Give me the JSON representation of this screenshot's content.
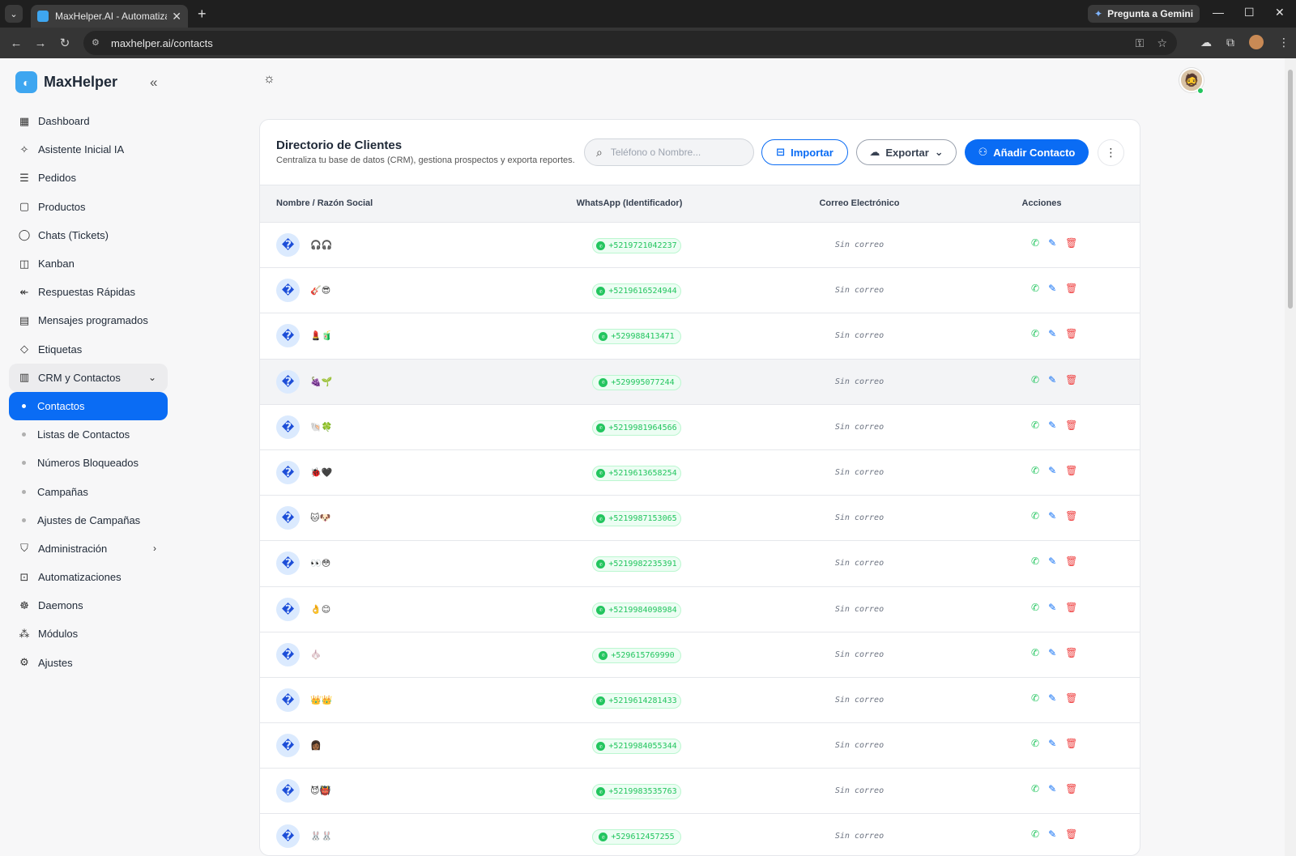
{
  "browser": {
    "tab_title": "MaxHelper.AI - Automatiza tu a",
    "url": "maxhelper.ai/contacts",
    "gemini_label": "Pregunta a Gemini"
  },
  "sidebar": {
    "brand": "MaxHelper",
    "items": [
      {
        "label": "Dashboard",
        "icon": "dashboard-icon"
      },
      {
        "label": "Asistente Inicial IA",
        "icon": "sparkle-icon"
      },
      {
        "label": "Pedidos",
        "icon": "document-icon"
      },
      {
        "label": "Productos",
        "icon": "shopping-bag-icon"
      },
      {
        "label": "Chats (Tickets)",
        "icon": "whatsapp-icon"
      },
      {
        "label": "Kanban",
        "icon": "kanban-icon"
      },
      {
        "label": "Respuestas Rápidas",
        "icon": "reply-all-icon"
      },
      {
        "label": "Mensajes programados",
        "icon": "calendar-icon"
      },
      {
        "label": "Etiquetas",
        "icon": "tag-icon"
      }
    ],
    "crm_group": {
      "label": "CRM y Contactos",
      "icon": "contacts-book-icon"
    },
    "crm_subitems": [
      {
        "label": "Contactos",
        "active": true
      },
      {
        "label": "Listas de Contactos"
      },
      {
        "label": "Números Bloqueados"
      },
      {
        "label": "Campañas"
      },
      {
        "label": "Ajustes de Campañas"
      }
    ],
    "bottom_items": [
      {
        "label": "Administración",
        "icon": "shield-user-icon"
      },
      {
        "label": "Automatizaciones",
        "icon": "robot-icon"
      },
      {
        "label": "Daemons",
        "icon": "daemon-icon"
      },
      {
        "label": "Módulos",
        "icon": "modules-icon"
      },
      {
        "label": "Ajustes",
        "icon": "gear-icon"
      }
    ]
  },
  "card": {
    "title": "Directorio de Clientes",
    "subtitle": "Centraliza tu base de datos (CRM), gestiona prospectos y exporta reportes.",
    "search_placeholder": "Teléfono o Nombre...",
    "import_label": "Importar",
    "export_label": "Exportar",
    "add_label": "Añadir Contacto"
  },
  "table": {
    "headers": {
      "name": "Nombre / Razón Social",
      "whatsapp": "WhatsApp (Identificador)",
      "email": "Correo Electrónico",
      "actions": "Acciones"
    },
    "avatar_glyph": "�",
    "no_email": "Sin correo",
    "rows": [
      {
        "name": "🎧🎧",
        "phone": "+5219721042237"
      },
      {
        "name": "🎸😎",
        "phone": "+5219616524944"
      },
      {
        "name": "💄🧃",
        "phone": "+529988413471"
      },
      {
        "name": "🍇🌱",
        "phone": "+529995077244"
      },
      {
        "name": "🐚🍀",
        "phone": "+5219981964566"
      },
      {
        "name": "🐞🖤",
        "phone": "+5219613658254"
      },
      {
        "name": "🐱🐶",
        "phone": "+5219987153065"
      },
      {
        "name": "👀😳",
        "phone": "+5219982235391"
      },
      {
        "name": "👌😊",
        "phone": "+5219984098984"
      },
      {
        "name": "🧄",
        "phone": "+529615769990"
      },
      {
        "name": "👑👑",
        "phone": "+5219614281433"
      },
      {
        "name": "👩🏾",
        "phone": "+5219984055344"
      },
      {
        "name": "😈👹",
        "phone": "+5219983535763"
      },
      {
        "name": "🐰🐰",
        "phone": "+529612457255"
      }
    ]
  },
  "colors": {
    "primary": "#0a6cf4",
    "whatsapp": "#22c55e",
    "danger": "#ef4444"
  }
}
